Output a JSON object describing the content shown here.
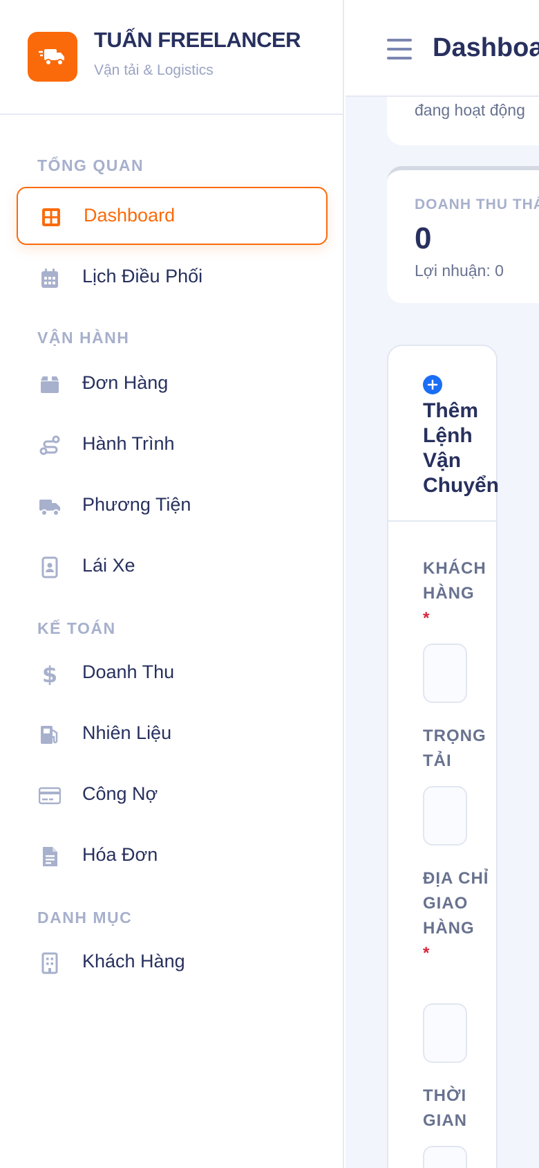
{
  "brand": {
    "title": "TUẤN FREELANCER",
    "subtitle": "Vận tải & Logistics"
  },
  "sidebar": {
    "sections": [
      {
        "label": "TỔNG QUAN"
      },
      {
        "label": "VẬN HÀNH"
      },
      {
        "label": "KẾ TOÁN"
      },
      {
        "label": "DANH MỤC"
      }
    ],
    "items": [
      {
        "label": "Dashboard",
        "icon": "grid-icon",
        "active": true
      },
      {
        "label": "Lịch Điều Phối",
        "icon": "calendar-icon"
      },
      {
        "label": "Đơn Hàng",
        "icon": "box-icon"
      },
      {
        "label": "Hành Trình",
        "icon": "route-icon"
      },
      {
        "label": "Phương Tiện",
        "icon": "truck-icon"
      },
      {
        "label": "Lái Xe",
        "icon": "id-card-icon"
      },
      {
        "label": "Doanh Thu",
        "icon": "dollar-icon"
      },
      {
        "label": "Nhiên Liệu",
        "icon": "fuel-icon"
      },
      {
        "label": "Công Nợ",
        "icon": "credit-card-icon"
      },
      {
        "label": "Hóa Đơn",
        "icon": "invoice-icon"
      },
      {
        "label": "Khách Hàng",
        "icon": "building-icon"
      }
    ]
  },
  "header": {
    "title": "Dashboard"
  },
  "cards": {
    "status_text": "đang hoạt động",
    "revenue": {
      "label": "DOANH THU THÁNG",
      "value": "0",
      "profit": "Lợi nhuận: 0"
    }
  },
  "form": {
    "title": "Thêm Lệnh Vận Chuyển",
    "fields": [
      {
        "label": "KHÁCH HÀNG",
        "required": "*"
      },
      {
        "label": "TRỌNG TẢI"
      },
      {
        "label": "ĐỊA CHỈ GIAO HÀNG",
        "required": "*"
      },
      {
        "label": "THỜI GIAN"
      }
    ]
  },
  "colors": {
    "accent": "#fb6a0a",
    "primary_text": "#27305e",
    "muted": "#a7b0cc",
    "blue": "#1a6ef5"
  }
}
